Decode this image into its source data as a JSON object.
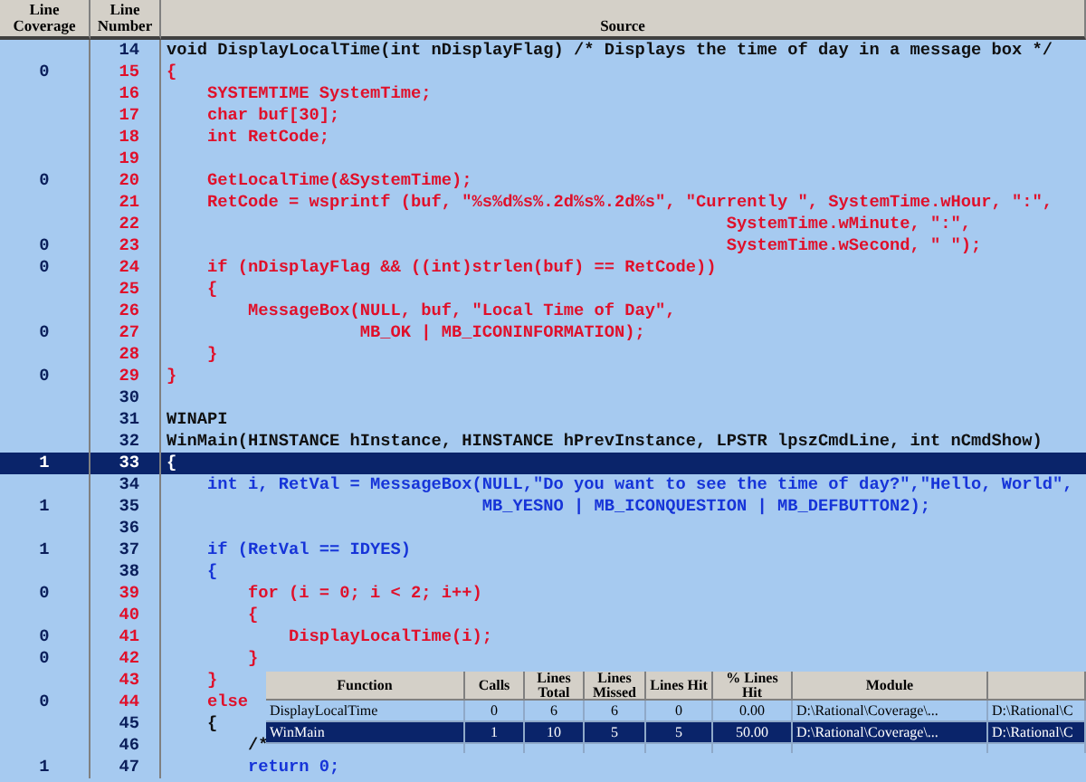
{
  "source_view": {
    "columns": [
      "Line Coverage",
      "Line Number",
      "Source"
    ],
    "lines": [
      {
        "number": "14",
        "kind": "plain",
        "selected": false,
        "code": "void DisplayLocalTime(int nDisplayFlag) /* Displays the time of day in a message box */"
      },
      {
        "number": "15",
        "coverage": "0",
        "kind": "missed",
        "selected": false,
        "code": "{"
      },
      {
        "number": "16",
        "kind": "missed",
        "selected": false,
        "code": "    SYSTEMTIME SystemTime;"
      },
      {
        "number": "17",
        "kind": "missed",
        "selected": false,
        "code": "    char buf[30];"
      },
      {
        "number": "18",
        "kind": "missed",
        "selected": false,
        "code": "    int RetCode;"
      },
      {
        "number": "19",
        "kind": "missed",
        "selected": false
      },
      {
        "number": "20",
        "coverage": "0",
        "kind": "missed",
        "selected": false,
        "code": "    GetLocalTime(&SystemTime);"
      },
      {
        "number": "21",
        "kind": "missed",
        "selected": false,
        "code": "    RetCode = wsprintf (buf, \"%s%d%s%.2d%s%.2d%s\", \"Currently \", SystemTime.wHour, \":\","
      },
      {
        "number": "22",
        "kind": "missed",
        "selected": false,
        "code": "                                                       SystemTime.wMinute, \":\","
      },
      {
        "number": "23",
        "coverage": "0",
        "kind": "missed",
        "selected": false,
        "code": "                                                       SystemTime.wSecond, \" \");"
      },
      {
        "number": "24",
        "coverage": "0",
        "kind": "missed",
        "selected": false,
        "code": "    if (nDisplayFlag && ((int)strlen(buf) == RetCode))"
      },
      {
        "number": "25",
        "kind": "missed",
        "selected": false,
        "code": "    {"
      },
      {
        "number": "26",
        "kind": "missed",
        "selected": false,
        "code": "        MessageBox(NULL, buf, \"Local Time of Day\","
      },
      {
        "number": "27",
        "coverage": "0",
        "kind": "missed",
        "selected": false,
        "code": "                   MB_OK | MB_ICONINFORMATION);"
      },
      {
        "number": "28",
        "kind": "missed",
        "selected": false,
        "code": "    }"
      },
      {
        "number": "29",
        "coverage": "0",
        "kind": "missed",
        "selected": false,
        "code": "}"
      },
      {
        "number": "30",
        "kind": "plain",
        "selected": false
      },
      {
        "number": "31",
        "kind": "plain",
        "selected": false,
        "code": "WINAPI"
      },
      {
        "number": "32",
        "kind": "plain",
        "selected": false,
        "code": "WinMain(HINSTANCE hInstance, HINSTANCE hPrevInstance, LPSTR lpszCmdLine, int nCmdShow)"
      },
      {
        "number": "33",
        "coverage": "1",
        "kind": "hit",
        "selected": true,
        "code": "{"
      },
      {
        "number": "34",
        "kind": "hit",
        "selected": false,
        "code": "    int i, RetVal = MessageBox(NULL,\"Do you want to see the time of day?\",\"Hello, World\","
      },
      {
        "number": "35",
        "coverage": "1",
        "kind": "hit",
        "selected": false,
        "code": "                               MB_YESNO | MB_ICONQUESTION | MB_DEFBUTTON2);"
      },
      {
        "number": "36",
        "kind": "hit",
        "selected": false
      },
      {
        "number": "37",
        "coverage": "1",
        "kind": "hit",
        "selected": false,
        "code": "    if (RetVal == IDYES)"
      },
      {
        "number": "38",
        "kind": "hit",
        "selected": false,
        "code": "    {"
      },
      {
        "number": "39",
        "coverage": "0",
        "kind": "missed",
        "selected": false,
        "code": "        for (i = 0; i < 2; i++)"
      },
      {
        "number": "40",
        "kind": "missed",
        "selected": false,
        "code": "        {"
      },
      {
        "number": "41",
        "coverage": "0",
        "kind": "missed",
        "selected": false,
        "code": "            DisplayLocalTime(i);"
      },
      {
        "number": "42",
        "coverage": "0",
        "kind": "missed",
        "selected": false,
        "code": "        }"
      },
      {
        "number": "43",
        "kind": "missed",
        "selected": false,
        "code": "    }"
      },
      {
        "number": "44",
        "coverage": "0",
        "kind": "missed",
        "selected": false,
        "code": "    else"
      },
      {
        "number": "45",
        "kind": "plain",
        "selected": false,
        "code": "    {"
      },
      {
        "number": "46",
        "kind": "plain",
        "selected": false,
        "code": "        /*"
      },
      {
        "number": "47",
        "coverage": "1",
        "kind": "hit",
        "selected": false,
        "code": "        return 0;"
      }
    ]
  },
  "function_table": {
    "columns": [
      "Function",
      "Calls",
      "Lines Total",
      "Lines Missed",
      "Lines Hit",
      "% Lines Hit",
      "Module"
    ],
    "rows": [
      {
        "selected": false,
        "cells": [
          "DisplayLocalTime",
          "0",
          "6",
          "6",
          "0",
          "0.00",
          "D:\\Rational\\Coverage\\...",
          "D:\\Rational\\C"
        ]
      },
      {
        "selected": true,
        "cells": [
          "WinMain",
          "1",
          "10",
          "5",
          "5",
          "50.00",
          "D:\\Rational\\Coverage\\...",
          "D:\\Rational\\C"
        ]
      }
    ]
  }
}
